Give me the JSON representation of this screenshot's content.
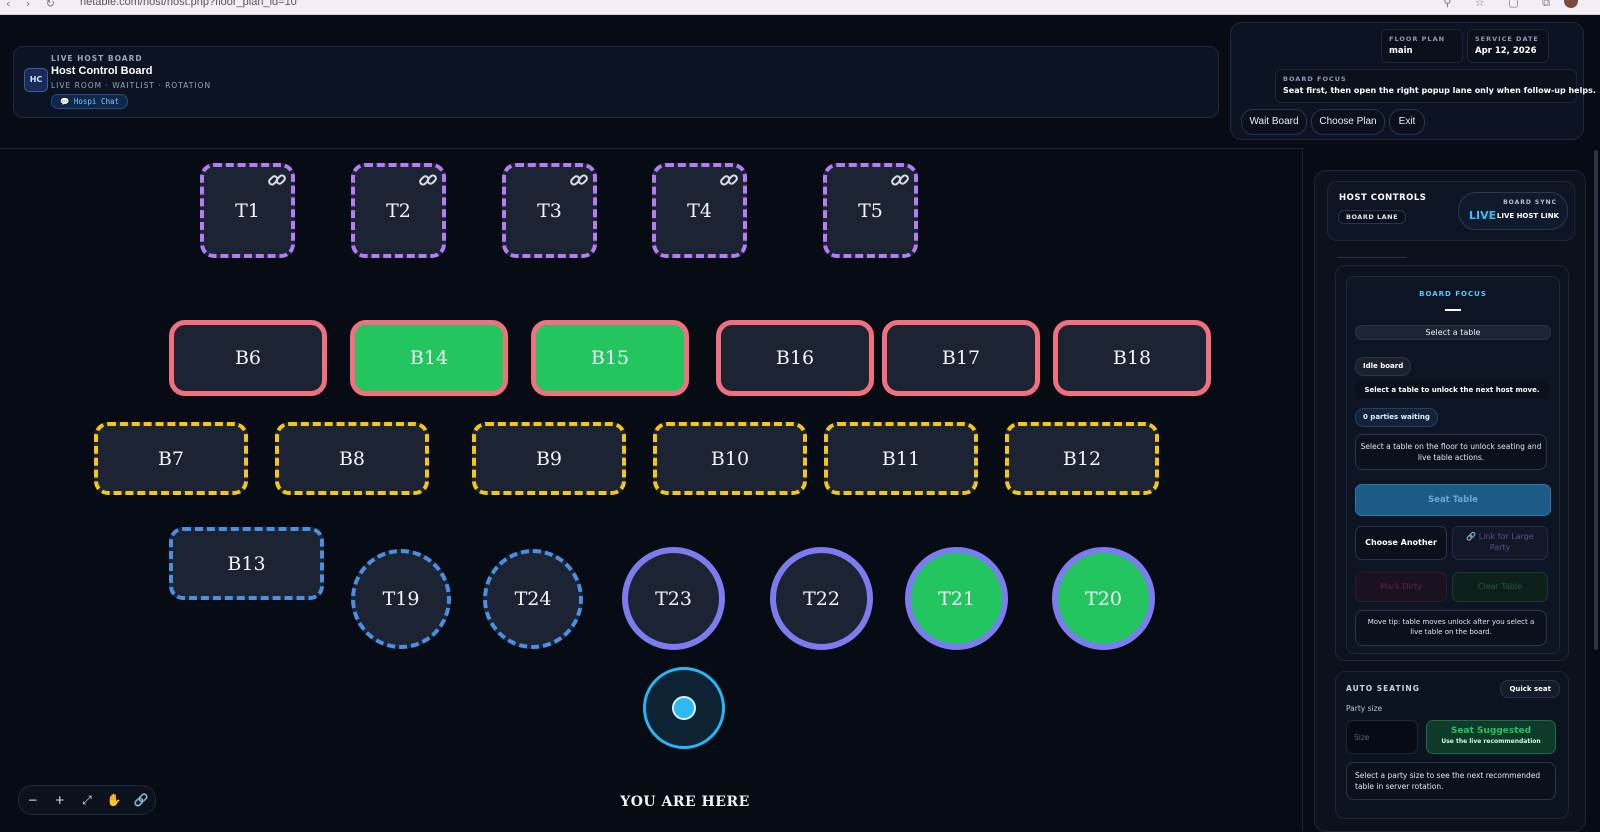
{
  "browser": {
    "url": "hetable.com/host/host.php?floor_plan_id=10"
  },
  "header": {
    "eyebrow": "LIVE HOST BOARD",
    "title": "Host Control Board",
    "subtitle": "LIVE ROOM · WAITLIST · ROTATION",
    "chat_label": "💬 Hospi Chat"
  },
  "meta": {
    "floor_plan_label": "FLOOR PLAN",
    "floor_plan_value": "main",
    "service_date_label": "SERVICE DATE",
    "service_date_value": "Apr 12, 2026",
    "board_focus_label": "BOARD FOCUS",
    "board_focus_value": "Seat first, then open the right popup lane only when follow-up helps."
  },
  "actions": {
    "wait_board": "Wait Board",
    "choose_plan": "Choose Plan",
    "exit": "Exit"
  },
  "tables": {
    "T1": "T1",
    "T2": "T2",
    "T3": "T3",
    "T4": "T4",
    "T5": "T5",
    "B6": "B6",
    "B14": "B14",
    "B15": "B15",
    "B16": "B16",
    "B17": "B17",
    "B18": "B18",
    "B7": "B7",
    "B8": "B8",
    "B9": "B9",
    "B10": "B10",
    "B11": "B11",
    "B12": "B12",
    "B13": "B13",
    "T19": "T19",
    "T24": "T24",
    "T23": "T23",
    "T22": "T22",
    "T21": "T21",
    "T20": "T20"
  },
  "location": {
    "label": "YOU ARE HERE"
  },
  "zoom": {
    "minus": "−",
    "plus": "+",
    "fit": "⤢",
    "grab": "✋",
    "link": "🔗"
  },
  "host_controls": {
    "title": "HOST CONTROLS",
    "lane_chip": "BOARD LANE",
    "sync_label": "BOARD SYNC",
    "sync_live": "LIVE",
    "sync_link": "LIVE HOST LINK"
  },
  "focus": {
    "eyebrow": "BOARD FOCUS",
    "select_prompt": "Select a table",
    "status": "Idle board",
    "hint": "Select a table to unlock the next host move.",
    "waiting": "0 parties waiting",
    "info": "Select a table on the floor to unlock seating and live table actions.",
    "seat_table": "Seat Table",
    "choose_another": "Choose Another",
    "link_large": "🔗 Link for Large Party",
    "mark_dirty": "Mark Dirty",
    "clear_table": "Clear Table",
    "move_tip": "Move tip: table moves unlock after you select a live table on the board."
  },
  "auto_seating": {
    "title": "AUTO SEATING",
    "quick_seat": "Quick seat",
    "party_size_label": "Party size",
    "size_placeholder": "Size",
    "suggest_title": "Seat Suggested",
    "suggest_sub": "Use the live recommendation",
    "info": "Select a party size to see the next recommended table in server rotation."
  },
  "colors": {
    "linked": "#b57cf5",
    "occupied_border": "#f07080",
    "occupied_fill": "#22c55e",
    "reserved": "#f5c518",
    "bar": "#4a90e2",
    "booth": "#7c7cf0",
    "accent": "#38bdf8"
  }
}
